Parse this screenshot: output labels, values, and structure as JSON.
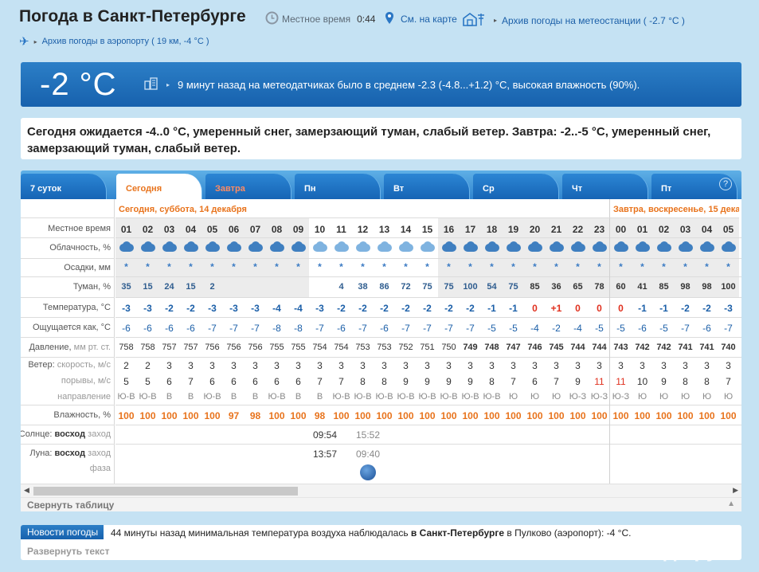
{
  "header": {
    "title": "Погода в Санкт-Петербурге",
    "local_time_label": "Местное время",
    "local_time_value": "0:44",
    "map_link": "См. на карте",
    "station_archive": "Архив погоды на метеостанции ( -2.7 °C )",
    "airport_archive": "Архив погоды в аэропорту ( 19 км, -4 °C )"
  },
  "current": {
    "temp": "-2 °C",
    "text": "9 минут назад на метеодатчиках было в среднем -2.3 (-4.8...+1.2) °C, высокая влажность (90%)."
  },
  "forecast_text": "Сегодня ожидается -4..0 °C, умеренный снег, замерзающий туман, слабый ветер. Завтра: -2..-5 °C, умеренный снег, замерзающий туман, слабый ветер.",
  "tabs": [
    {
      "label": "7 суток"
    },
    {
      "label": "Сегодня"
    },
    {
      "label": "Завтра"
    },
    {
      "label": "Пн"
    },
    {
      "label": "Вт"
    },
    {
      "label": "Ср"
    },
    {
      "label": "Чт"
    },
    {
      "label": "Пт"
    }
  ],
  "help_label": "?",
  "days": {
    "today": "Сегодня, суббота, 14 декабря",
    "tomorrow": "Завтра, воскресенье, 15 декабря"
  },
  "row_labels": {
    "time": "Местное время",
    "cloud": "Облачность, %",
    "precip": "Осадки, мм",
    "fog": "Туман, %",
    "temp": "Температура, °C",
    "feels": "Ощущается как, °C",
    "pressure_a": "Давление,",
    "pressure_b": "мм рт. ст.",
    "wind_a": "Ветер:",
    "wind_b": "скорость, м/с",
    "gusts": "порывы, м/с",
    "direction": "направление",
    "humidity": "Влажность, %",
    "sun_a": "Солнце:",
    "sun_b": "восход",
    "sun_c": "заход",
    "moon_a": "Луна:",
    "moon_b": "восход",
    "moon_c": "заход",
    "phase": "фаза"
  },
  "hours": [
    "01",
    "02",
    "03",
    "04",
    "05",
    "06",
    "07",
    "08",
    "09",
    "10",
    "11",
    "12",
    "13",
    "14",
    "15",
    "16",
    "17",
    "18",
    "19",
    "20",
    "21",
    "22",
    "23",
    "00",
    "01",
    "02",
    "03",
    "04",
    "05"
  ],
  "fog": [
    "35",
    "15",
    "24",
    "15",
    "2",
    "",
    "",
    "",
    "",
    "",
    "4",
    "38",
    "86",
    "72",
    "75",
    "75",
    "100",
    "54",
    "75",
    "85",
    "36",
    "65",
    "78",
    "60",
    "41",
    "85",
    "98",
    "98",
    "100"
  ],
  "temp": [
    "-3",
    "-3",
    "-2",
    "-2",
    "-3",
    "-3",
    "-3",
    "-4",
    "-4",
    "-3",
    "-2",
    "-2",
    "-2",
    "-2",
    "-2",
    "-2",
    "-2",
    "-1",
    "-1",
    "0",
    "+1",
    "0",
    "0",
    "0",
    "-1",
    "-1",
    "-2",
    "-2",
    "-3"
  ],
  "feels": [
    "-6",
    "-6",
    "-6",
    "-6",
    "-7",
    "-7",
    "-7",
    "-8",
    "-8",
    "-7",
    "-6",
    "-7",
    "-6",
    "-7",
    "-7",
    "-7",
    "-7",
    "-5",
    "-5",
    "-4",
    "-2",
    "-4",
    "-5",
    "-5",
    "-6",
    "-5",
    "-7",
    "-6",
    "-7"
  ],
  "pressure": [
    "758",
    "758",
    "757",
    "757",
    "756",
    "756",
    "756",
    "755",
    "755",
    "754",
    "754",
    "753",
    "753",
    "752",
    "751",
    "750",
    "749",
    "748",
    "747",
    "746",
    "745",
    "744",
    "744",
    "743",
    "742",
    "742",
    "741",
    "741",
    "740"
  ],
  "wind": [
    "2",
    "2",
    "3",
    "3",
    "3",
    "3",
    "3",
    "3",
    "3",
    "3",
    "3",
    "3",
    "3",
    "3",
    "3",
    "3",
    "3",
    "3",
    "3",
    "3",
    "3",
    "3",
    "3",
    "3",
    "3",
    "3",
    "3",
    "3",
    "3"
  ],
  "gusts": [
    "5",
    "5",
    "6",
    "7",
    "6",
    "6",
    "6",
    "6",
    "6",
    "7",
    "7",
    "8",
    "8",
    "9",
    "9",
    "9",
    "9",
    "8",
    "7",
    "6",
    "7",
    "9",
    "11",
    "11",
    "10",
    "9",
    "8",
    "8",
    "7"
  ],
  "direction": [
    "Ю-В",
    "Ю-В",
    "В",
    "В",
    "Ю-В",
    "В",
    "В",
    "Ю-В",
    "В",
    "В",
    "Ю-В",
    "Ю-В",
    "Ю-В",
    "Ю-В",
    "Ю-В",
    "Ю-В",
    "Ю-В",
    "Ю-В",
    "Ю",
    "Ю",
    "Ю",
    "Ю-З",
    "Ю-З",
    "Ю-З",
    "Ю",
    "Ю",
    "Ю",
    "Ю",
    "Ю"
  ],
  "humidity": [
    "100",
    "100",
    "100",
    "100",
    "100",
    "97",
    "98",
    "100",
    "100",
    "98",
    "100",
    "100",
    "100",
    "100",
    "100",
    "100",
    "100",
    "100",
    "100",
    "100",
    "100",
    "100",
    "100",
    "100",
    "100",
    "100",
    "100",
    "100",
    "100"
  ],
  "sun": {
    "rise": "09:54",
    "set": "15:52"
  },
  "moon": {
    "rise": "13:57",
    "set": "09:40"
  },
  "collapse_label": "Свернуть таблицу",
  "news": {
    "label": "Новости погоды",
    "text_a": "44 минуты назад минимальная температура воздуха наблюдалась ",
    "text_b": "в Санкт-Петербурге",
    "text_c": " в Пулково (аэропорт): -4 °C.",
    "expand": "Развернуть текст"
  },
  "watermark": "асиенда.ру",
  "colors": {
    "accent": "#1761ad",
    "orange": "#e8731c",
    "red": "#e0301e"
  }
}
